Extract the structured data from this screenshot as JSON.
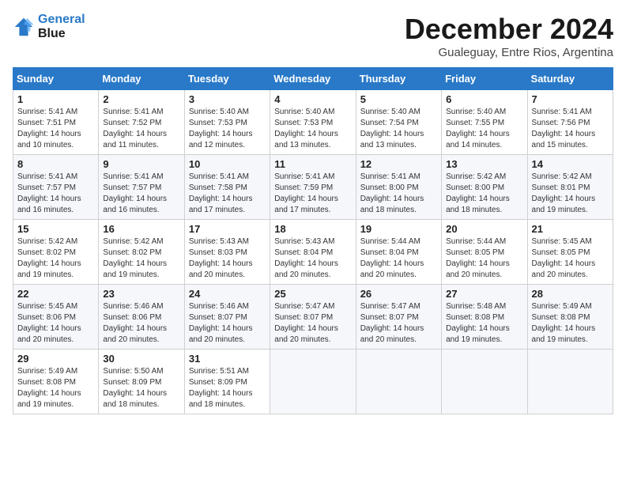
{
  "logo": {
    "line1": "General",
    "line2": "Blue"
  },
  "title": "December 2024",
  "location": "Gualeguay, Entre Rios, Argentina",
  "days_of_week": [
    "Sunday",
    "Monday",
    "Tuesday",
    "Wednesday",
    "Thursday",
    "Friday",
    "Saturday"
  ],
  "weeks": [
    [
      {
        "day": "1",
        "sunrise": "5:41 AM",
        "sunset": "7:51 PM",
        "daylight": "14 hours and 10 minutes."
      },
      {
        "day": "2",
        "sunrise": "5:41 AM",
        "sunset": "7:52 PM",
        "daylight": "14 hours and 11 minutes."
      },
      {
        "day": "3",
        "sunrise": "5:40 AM",
        "sunset": "7:53 PM",
        "daylight": "14 hours and 12 minutes."
      },
      {
        "day": "4",
        "sunrise": "5:40 AM",
        "sunset": "7:53 PM",
        "daylight": "14 hours and 13 minutes."
      },
      {
        "day": "5",
        "sunrise": "5:40 AM",
        "sunset": "7:54 PM",
        "daylight": "14 hours and 13 minutes."
      },
      {
        "day": "6",
        "sunrise": "5:40 AM",
        "sunset": "7:55 PM",
        "daylight": "14 hours and 14 minutes."
      },
      {
        "day": "7",
        "sunrise": "5:41 AM",
        "sunset": "7:56 PM",
        "daylight": "14 hours and 15 minutes."
      }
    ],
    [
      {
        "day": "8",
        "sunrise": "5:41 AM",
        "sunset": "7:57 PM",
        "daylight": "14 hours and 16 minutes."
      },
      {
        "day": "9",
        "sunrise": "5:41 AM",
        "sunset": "7:57 PM",
        "daylight": "14 hours and 16 minutes."
      },
      {
        "day": "10",
        "sunrise": "5:41 AM",
        "sunset": "7:58 PM",
        "daylight": "14 hours and 17 minutes."
      },
      {
        "day": "11",
        "sunrise": "5:41 AM",
        "sunset": "7:59 PM",
        "daylight": "14 hours and 17 minutes."
      },
      {
        "day": "12",
        "sunrise": "5:41 AM",
        "sunset": "8:00 PM",
        "daylight": "14 hours and 18 minutes."
      },
      {
        "day": "13",
        "sunrise": "5:42 AM",
        "sunset": "8:00 PM",
        "daylight": "14 hours and 18 minutes."
      },
      {
        "day": "14",
        "sunrise": "5:42 AM",
        "sunset": "8:01 PM",
        "daylight": "14 hours and 19 minutes."
      }
    ],
    [
      {
        "day": "15",
        "sunrise": "5:42 AM",
        "sunset": "8:02 PM",
        "daylight": "14 hours and 19 minutes."
      },
      {
        "day": "16",
        "sunrise": "5:42 AM",
        "sunset": "8:02 PM",
        "daylight": "14 hours and 19 minutes."
      },
      {
        "day": "17",
        "sunrise": "5:43 AM",
        "sunset": "8:03 PM",
        "daylight": "14 hours and 20 minutes."
      },
      {
        "day": "18",
        "sunrise": "5:43 AM",
        "sunset": "8:04 PM",
        "daylight": "14 hours and 20 minutes."
      },
      {
        "day": "19",
        "sunrise": "5:44 AM",
        "sunset": "8:04 PM",
        "daylight": "14 hours and 20 minutes."
      },
      {
        "day": "20",
        "sunrise": "5:44 AM",
        "sunset": "8:05 PM",
        "daylight": "14 hours and 20 minutes."
      },
      {
        "day": "21",
        "sunrise": "5:45 AM",
        "sunset": "8:05 PM",
        "daylight": "14 hours and 20 minutes."
      }
    ],
    [
      {
        "day": "22",
        "sunrise": "5:45 AM",
        "sunset": "8:06 PM",
        "daylight": "14 hours and 20 minutes."
      },
      {
        "day": "23",
        "sunrise": "5:46 AM",
        "sunset": "8:06 PM",
        "daylight": "14 hours and 20 minutes."
      },
      {
        "day": "24",
        "sunrise": "5:46 AM",
        "sunset": "8:07 PM",
        "daylight": "14 hours and 20 minutes."
      },
      {
        "day": "25",
        "sunrise": "5:47 AM",
        "sunset": "8:07 PM",
        "daylight": "14 hours and 20 minutes."
      },
      {
        "day": "26",
        "sunrise": "5:47 AM",
        "sunset": "8:07 PM",
        "daylight": "14 hours and 20 minutes."
      },
      {
        "day": "27",
        "sunrise": "5:48 AM",
        "sunset": "8:08 PM",
        "daylight": "14 hours and 19 minutes."
      },
      {
        "day": "28",
        "sunrise": "5:49 AM",
        "sunset": "8:08 PM",
        "daylight": "14 hours and 19 minutes."
      }
    ],
    [
      {
        "day": "29",
        "sunrise": "5:49 AM",
        "sunset": "8:08 PM",
        "daylight": "14 hours and 19 minutes."
      },
      {
        "day": "30",
        "sunrise": "5:50 AM",
        "sunset": "8:09 PM",
        "daylight": "14 hours and 18 minutes."
      },
      {
        "day": "31",
        "sunrise": "5:51 AM",
        "sunset": "8:09 PM",
        "daylight": "14 hours and 18 minutes."
      },
      null,
      null,
      null,
      null
    ]
  ]
}
